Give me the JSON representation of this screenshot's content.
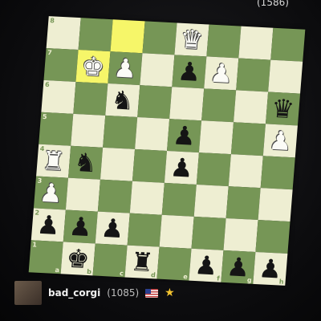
{
  "header": {
    "opponent_rating": "(1586)"
  },
  "board": {
    "highlights": [
      "b7",
      "c8"
    ],
    "rank_labels": [
      "8",
      "7",
      "6",
      "5",
      "4",
      "3",
      "2",
      "1"
    ],
    "file_labels": [
      "a",
      "b",
      "c",
      "d",
      "e",
      "f",
      "g",
      "h"
    ],
    "pieces": {
      "e8": {
        "glyph": "♛",
        "color": "w",
        "name": "white-queen"
      },
      "b7": {
        "glyph": "♚",
        "color": "w",
        "name": "white-king"
      },
      "c7": {
        "glyph": "♟",
        "color": "w",
        "name": "white-pawn"
      },
      "e7": {
        "glyph": "♟",
        "color": "b",
        "name": "black-pawn"
      },
      "f7": {
        "glyph": "♟",
        "color": "w",
        "name": "white-pawn"
      },
      "c6": {
        "glyph": "♞",
        "color": "b",
        "name": "black-knight"
      },
      "h6": {
        "glyph": "♛",
        "color": "b",
        "name": "black-queen"
      },
      "e5": {
        "glyph": "♟",
        "color": "b",
        "name": "black-pawn"
      },
      "h5": {
        "glyph": "♟",
        "color": "w",
        "name": "white-pawn"
      },
      "a4": {
        "glyph": "♜",
        "color": "w",
        "name": "white-rook"
      },
      "b4": {
        "glyph": "♞",
        "color": "b",
        "name": "black-knight"
      },
      "e4": {
        "glyph": "♟",
        "color": "b",
        "name": "black-pawn"
      },
      "a3": {
        "glyph": "♟",
        "color": "w",
        "name": "white-pawn"
      },
      "a2": {
        "glyph": "♟",
        "color": "b",
        "name": "black-pawn"
      },
      "b2": {
        "glyph": "♟",
        "color": "b",
        "name": "black-pawn"
      },
      "c2": {
        "glyph": "♟",
        "color": "b",
        "name": "black-pawn"
      },
      "f1": {
        "glyph": "♟",
        "color": "b",
        "name": "black-pawn"
      },
      "g1": {
        "glyph": "♟",
        "color": "b",
        "name": "black-pawn"
      },
      "h1": {
        "glyph": "♟",
        "color": "b",
        "name": "black-pawn"
      },
      "b1": {
        "glyph": "♚",
        "color": "b",
        "name": "black-king"
      },
      "d1": {
        "glyph": "♜",
        "color": "b",
        "name": "black-rook"
      }
    },
    "colors": {
      "light": "#eeeed2",
      "dark": "#769656",
      "highlight_light": "#f6f669",
      "highlight_dark": "#baca2b"
    }
  },
  "player": {
    "name": "bad_corgi",
    "rating": "(1085)",
    "flag_icon": "us-flag-icon",
    "badge_icon": "star-icon",
    "badge_glyph": "★"
  }
}
